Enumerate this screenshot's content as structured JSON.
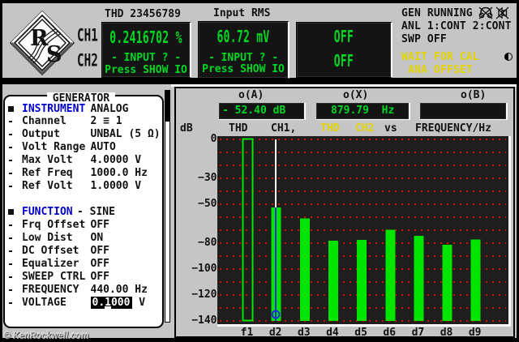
{
  "colors": {
    "background_gray": "#c5c5c5",
    "lcd_green": "#00d822",
    "bar_green": "#00e400",
    "grid_red": "#d80000",
    "warn_yellow": "#e3d300",
    "menu_blue": "#0000cc",
    "cursor_blue": "#2a2ae0",
    "cursor_white": "#f2f2f2",
    "panel_black": "#141414",
    "plot_black": "#1e1e1e"
  },
  "top_bar": {
    "logo": "R/S",
    "channel_labels": [
      "CH1",
      "CH2"
    ],
    "panels": [
      {
        "title": "THD 23456789",
        "value": "0.2416702 %",
        "line2": "- INPUT ? -",
        "line3": "Press SHOW IO"
      },
      {
        "title": "Input RMS",
        "value": "60.72 mV",
        "line2": "- INPUT ? -",
        "line3": "Press SHOW IO"
      },
      {
        "value_top": "OFF",
        "value_bottom": "OFF"
      }
    ],
    "status": {
      "line1": "GEN RUNNING",
      "icons": [
        "headphones-muted",
        "speaker-muted"
      ],
      "line2": "ANL 1:CONT 2:CONT",
      "line3": "SWP OFF",
      "warn1": "WAIT FOR CAL",
      "warn2": " ANA OFFSET"
    }
  },
  "generator_window": {
    "title": "GENERATOR",
    "items": [
      {
        "bullet": "square",
        "label": "INSTRUMENT",
        "value": "ANALOG",
        "label_blue": true
      },
      {
        "bullet": "dash",
        "label": "Channel",
        "value": "2 ≡ 1"
      },
      {
        "bullet": "dash",
        "label": "Output",
        "value": "UNBAL (5 Ω)"
      },
      {
        "bullet": "dash",
        "label": "Volt Range",
        "value": "AUTO"
      },
      {
        "bullet": "dash",
        "label": "Max Volt",
        "value": "4.0000 V"
      },
      {
        "bullet": "dash",
        "label": "Ref Freq",
        "value": "1000.0 Hz"
      },
      {
        "bullet": "dash",
        "label": "Ref Volt",
        "value": "1.0000 V"
      },
      {
        "blank": true
      },
      {
        "bullet": "square",
        "label": "FUNCTION",
        "value": "- SINE",
        "label_blue": true,
        "value_x": 89
      },
      {
        "bullet": "dash",
        "label": "Frq Offset",
        "value": "OFF"
      },
      {
        "bullet": "dash",
        "label": "Low Dist",
        "value": "ON"
      },
      {
        "bullet": "dash",
        "label": "DC Offset",
        "value": "OFF"
      },
      {
        "bullet": "dash",
        "label": "Equalizer",
        "value": "OFF"
      },
      {
        "bullet": "dash",
        "label": "SWEEP CTRL",
        "value": "OFF"
      },
      {
        "bullet": "dash",
        "label": "FREQUENCY",
        "value": "440.00 Hz"
      },
      {
        "bullet": "dash",
        "label": "VOLTAGE",
        "value": "0.1000",
        "highlight": true,
        "suffix": " V"
      }
    ]
  },
  "graph": {
    "readouts": [
      {
        "label": "o(A)",
        "value": "- 52.40 dB"
      },
      {
        "label": "o(X)",
        "value": "879.79  Hz"
      },
      {
        "label": "o(B)",
        "value": ""
      }
    ],
    "header": [
      {
        "text": "dB",
        "x": 11,
        "color": "black"
      },
      {
        "text": "THD",
        "x": 71,
        "color": "black"
      },
      {
        "text": "CH1,",
        "x": 123,
        "color": "black"
      },
      {
        "text": "THD",
        "x": 184,
        "color": "yellow"
      },
      {
        "text": "CH2",
        "x": 227,
        "color": "yellow"
      },
      {
        "text": "vs",
        "x": 263,
        "color": "black"
      },
      {
        "text": "FREQUENCY/Hz",
        "x": 301,
        "color": "black"
      }
    ]
  },
  "chart_data": {
    "type": "bar",
    "title": "THD CH1, THD CH2 vs FREQUENCY/Hz",
    "xlabel": "FREQUENCY/Hz",
    "ylabel": "dB",
    "categories": [
      "f1",
      "d2",
      "d3",
      "d4",
      "d5",
      "d6",
      "d7",
      "d8",
      "d9"
    ],
    "values": [
      0,
      -52.4,
      -61,
      -78.1,
      -77.6,
      -69.6,
      -74.3,
      -81.4,
      -77.1
    ],
    "bar_style": [
      "outline",
      "filled",
      "filled",
      "filled",
      "filled",
      "filled",
      "filled",
      "filled",
      "filled"
    ],
    "ylim": [
      -140,
      0
    ],
    "ytick_labels": [
      0,
      -30,
      -50,
      -80,
      -100,
      -120,
      -140
    ],
    "grid_step_db": 10,
    "grid": "dotted-red-horizontal",
    "cursor": {
      "category": "d2",
      "value_db": -52.4,
      "x_value_hz": 879.79,
      "marker": "circle"
    }
  },
  "watermark": "© KenRockwell.com"
}
